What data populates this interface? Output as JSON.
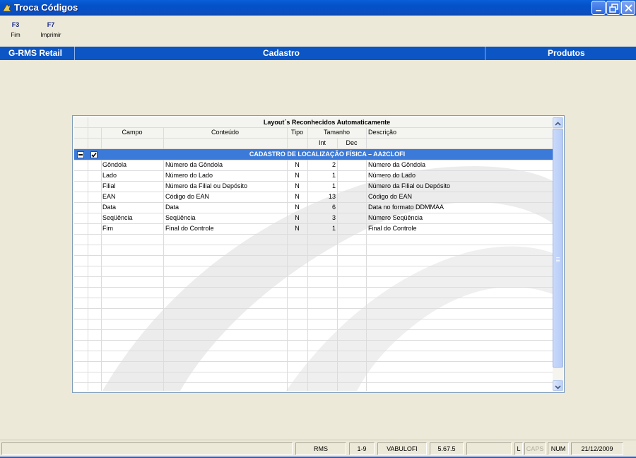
{
  "window": {
    "title": "Troca Códigos"
  },
  "toolbar": [
    {
      "key": "F3",
      "label": "Fim"
    },
    {
      "key": "F7",
      "label": "Imprimir"
    }
  ],
  "band": {
    "left": "G-RMS Retail",
    "center": "Cadastro",
    "right": "Produtos"
  },
  "grid": {
    "title": "Layout´s Reconhecidos Automaticamente",
    "columns": {
      "campo": "Campo",
      "conteudo": "Conteúdo",
      "tipo": "Tipo",
      "tamanho": "Tamanho",
      "int": "Int",
      "dec": "Dec",
      "descricao": "Descrição"
    },
    "group": {
      "title": "CADASTRO DE LOCALIZAÇÃO FÍSICA – AA2CLOFI",
      "expanded": true,
      "checked": true
    },
    "rows": [
      {
        "campo": "Gôndola",
        "conteudo": "Número da Gôndola",
        "tipo": "N",
        "int": "2",
        "dec": "",
        "descricao": "Número da Gôndola"
      },
      {
        "campo": "Lado",
        "conteudo": "Número do Lado",
        "tipo": "N",
        "int": "1",
        "dec": "",
        "descricao": "Número do Lado"
      },
      {
        "campo": "Filial",
        "conteudo": "Número da Filial ou Depósito",
        "tipo": "N",
        "int": "1",
        "dec": "",
        "descricao": "Número da Filial ou Depósito"
      },
      {
        "campo": "EAN",
        "conteudo": "Código do EAN",
        "tipo": "N",
        "int": "13",
        "dec": "",
        "descricao": "Código do EAN"
      },
      {
        "campo": "Data",
        "conteudo": "Data",
        "tipo": "N",
        "int": "6",
        "dec": "",
        "descricao": "Data no formato DDMMAA"
      },
      {
        "campo": "Seqüência",
        "conteudo": "Seqüência",
        "tipo": "N",
        "int": "3",
        "dec": "",
        "descricao": "Número Seqüência"
      },
      {
        "campo": "Fim",
        "conteudo": "Final do Controle",
        "tipo": "N",
        "int": "1",
        "dec": "",
        "descricao": "Final do Controle"
      }
    ]
  },
  "status": {
    "system": "RMS",
    "page": "1-9",
    "program": "VABULOFI",
    "version": "5.67.5",
    "lock": "L",
    "caps": "CAPS",
    "num": "NUM",
    "date": "21/12/2009"
  }
}
